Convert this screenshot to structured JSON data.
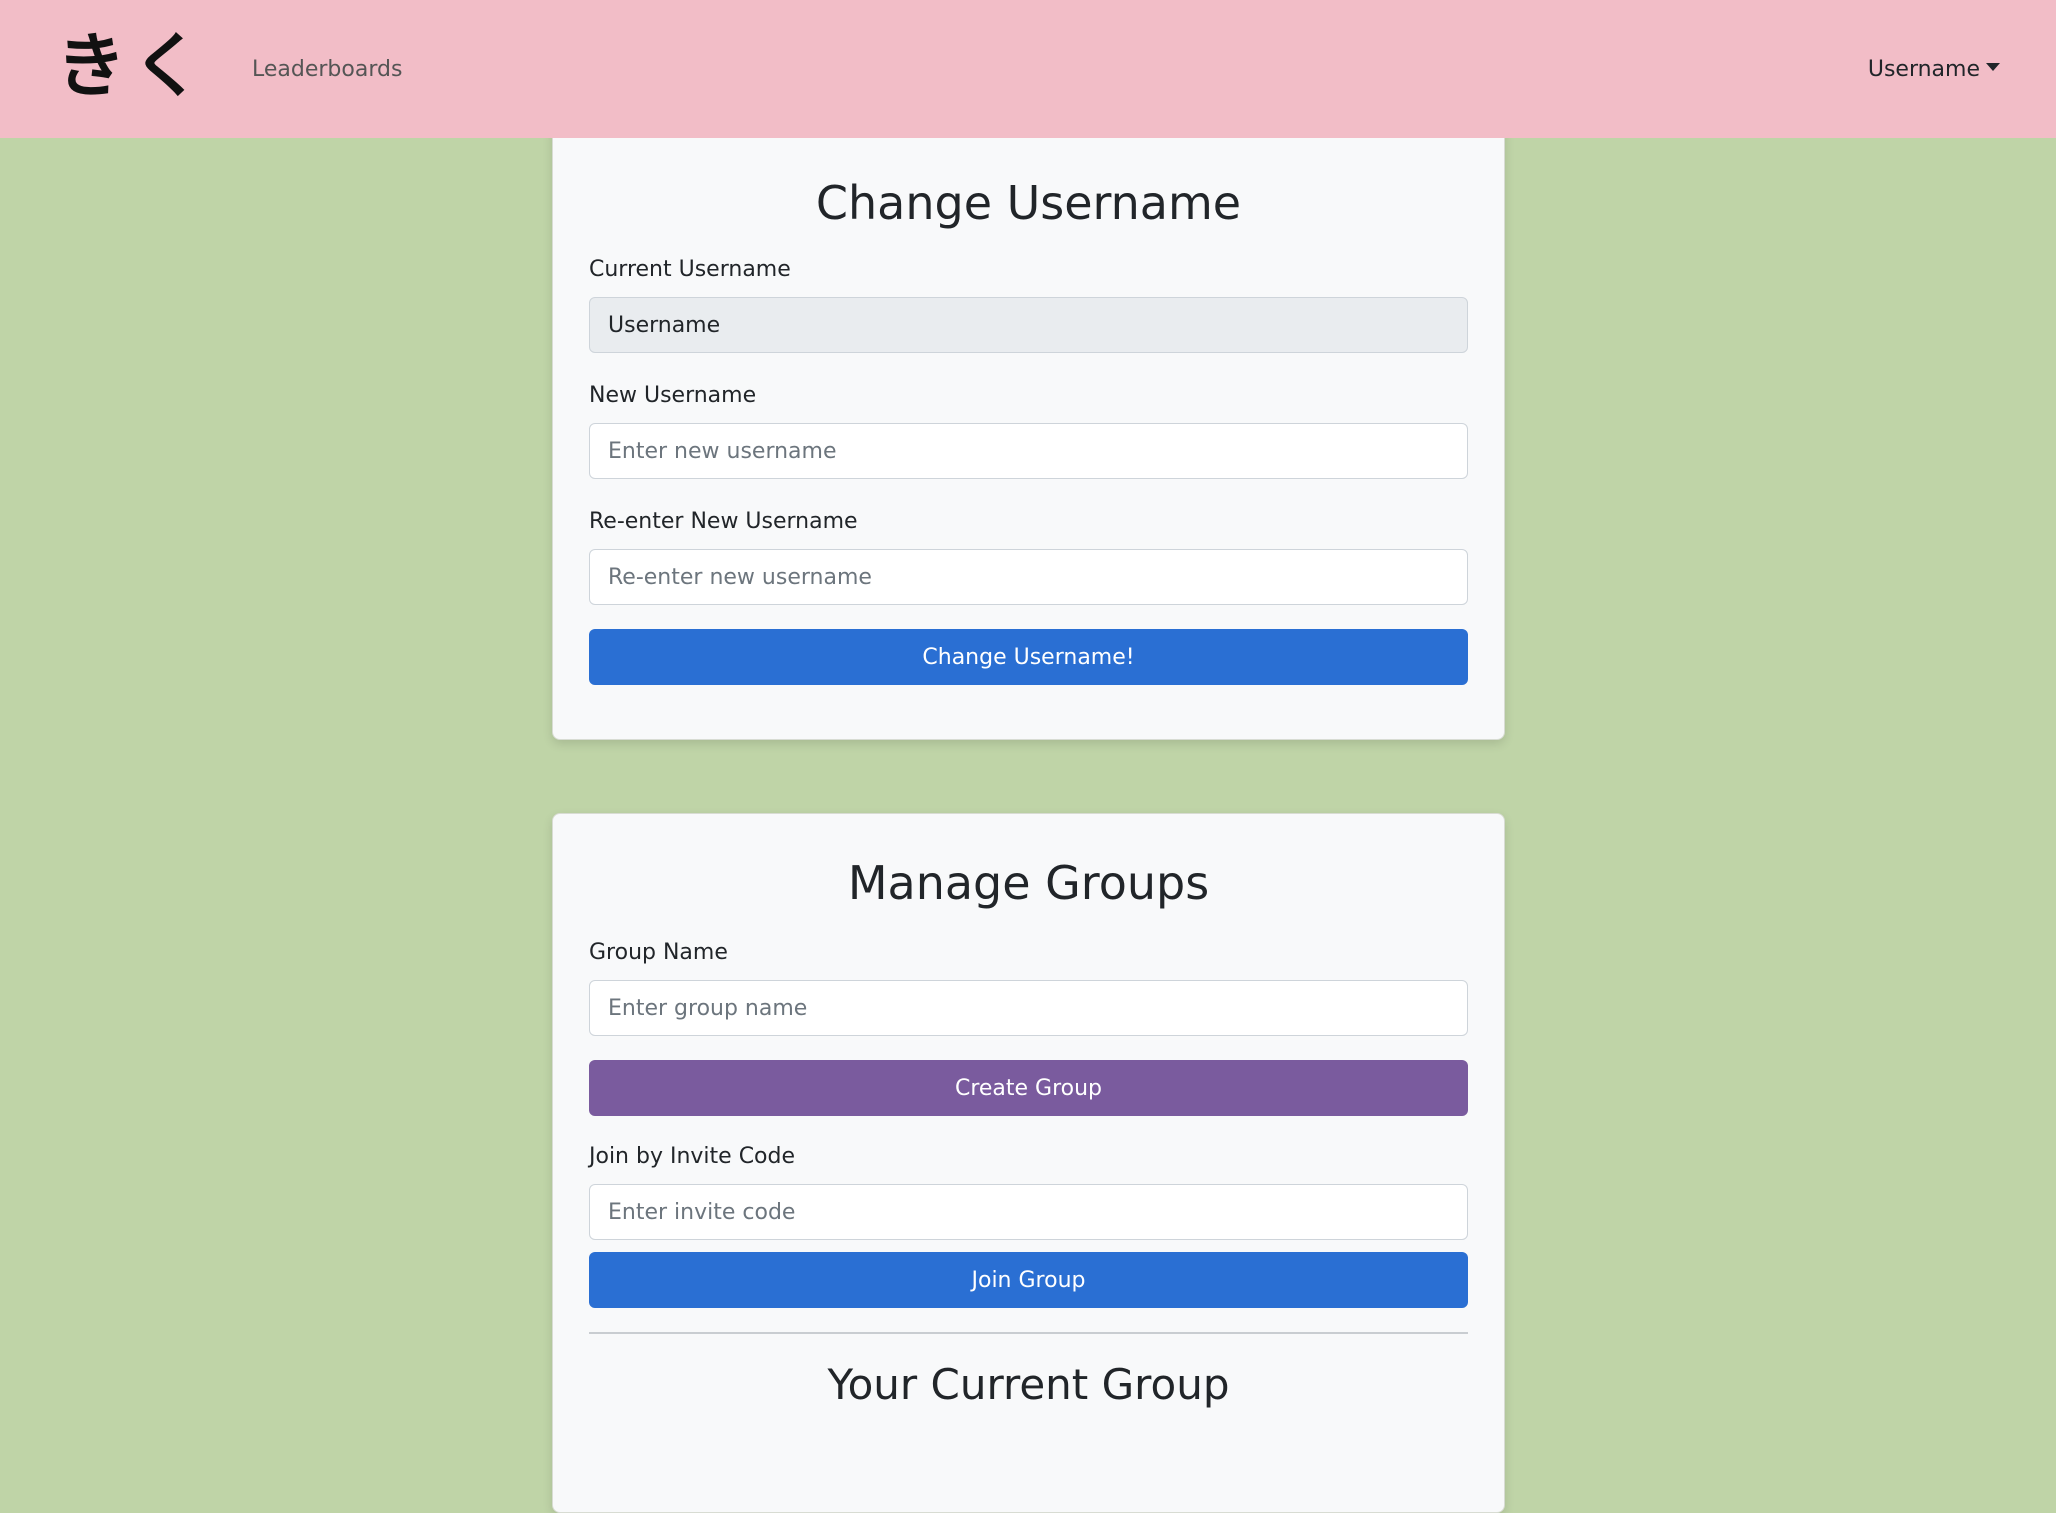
{
  "navbar": {
    "brand": "きく",
    "links": [
      "Leaderboards"
    ],
    "user_menu_label": "Username"
  },
  "change_username": {
    "title": "Change Username",
    "current_label": "Current Username",
    "current_value": "Username",
    "new_label": "New Username",
    "new_placeholder": "Enter new username",
    "reenter_label": "Re-enter New Username",
    "reenter_placeholder": "Re-enter new username",
    "submit_label": "Change Username!"
  },
  "manage_groups": {
    "title": "Manage Groups",
    "group_name_label": "Group Name",
    "group_name_placeholder": "Enter group name",
    "create_label": "Create Group",
    "invite_label": "Join by Invite Code",
    "invite_placeholder": "Enter invite code",
    "join_label": "Join Group",
    "current_group_title": "Your Current Group"
  },
  "colors": {
    "navbar": "#f2bdc7",
    "background": "#bfd4a7",
    "primary_button": "#2a6fd3",
    "create_button": "#7a5b9e"
  }
}
